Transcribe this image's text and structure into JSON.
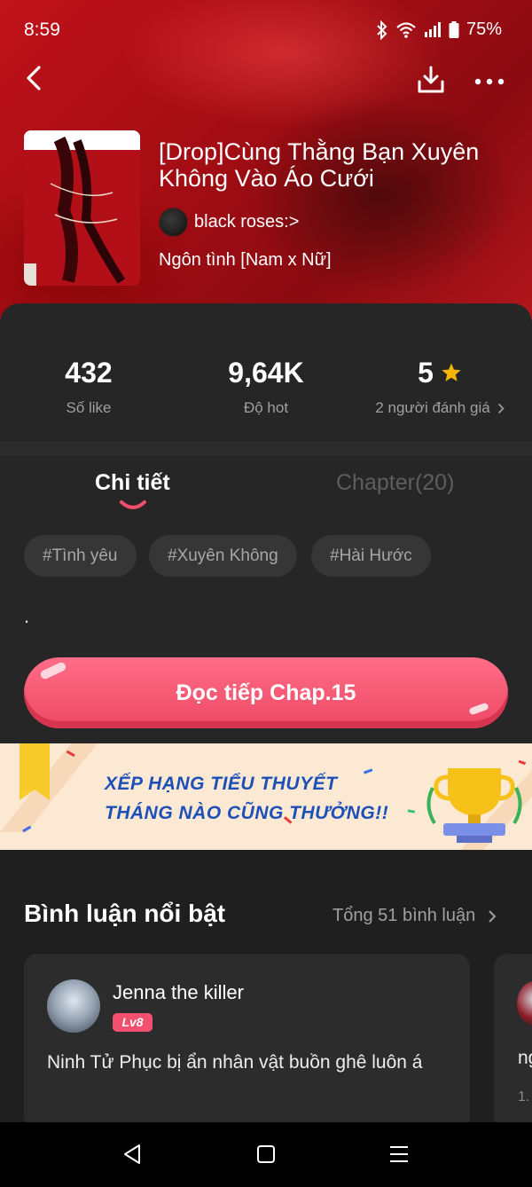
{
  "status": {
    "time": "8:59",
    "battery": "75%"
  },
  "icons": {
    "back": "chevron-left-icon",
    "download": "download-icon",
    "more": "more-dots-icon",
    "star": "star-icon",
    "chevron": "chevron-right-icon"
  },
  "book": {
    "title": "[Drop]Cùng Thằng Bạn Xuyên Không Vào Áo Cưới",
    "author": "black roses:>",
    "genre": "Ngôn tình [Nam x Nữ]"
  },
  "stats": [
    {
      "value": "432",
      "label": "Số like"
    },
    {
      "value": "9,64K",
      "label": "Độ hot"
    },
    {
      "value": "5",
      "label": "2 người đánh giá"
    }
  ],
  "tabs": {
    "detail": "Chi tiết",
    "chapter": "Chapter(20)"
  },
  "tags": [
    "#Tình yêu",
    "#Xuyên Không",
    "#Hài Hước"
  ],
  "description": ".",
  "cta": {
    "label": "Đọc tiếp Chap.15"
  },
  "banner": {
    "line1": "XẾP HẠNG TIỂU THUYẾT",
    "line2": "THÁNG NÀO CŨNG THƯỞNG!!"
  },
  "comments": {
    "title": "Bình luận nổi bật",
    "total": "Tổng 51 bình luận",
    "items": [
      {
        "name": "Jenna the killer",
        "level": "Lv8",
        "text": "Ninh Tử Phục bị ẩn nhân vật buồn ghê luôn á"
      },
      {
        "text": "ng",
        "sub": "1."
      }
    ]
  },
  "colors": {
    "accent": "#f04f6b",
    "heroRed": "#b3161c",
    "panel": "#262626"
  }
}
